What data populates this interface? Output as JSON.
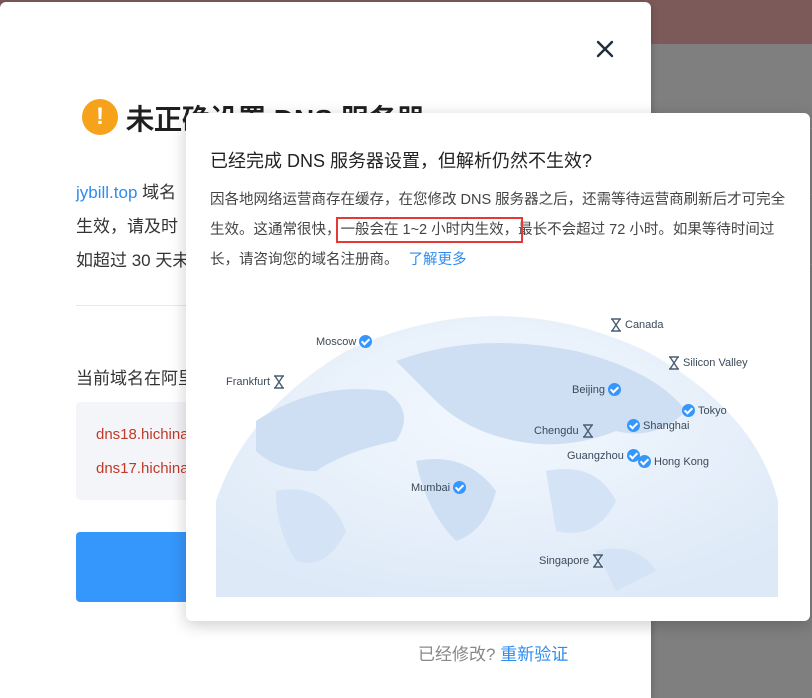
{
  "dialog": {
    "title": "未正确设置 DNS 服务器",
    "desc_domain": "jybill.top",
    "desc_line1": " 域名",
    "desc_line2": "生效，请及时",
    "desc_line3": "如超过 30 天未",
    "current_ns_label": "当前域名在阿里",
    "ns_list": [
      "dns18.hichina",
      "dns17.hichina"
    ],
    "footer_question": "已经修改?",
    "footer_link": "重新验证"
  },
  "popover": {
    "title": "已经完成 DNS 服务器设置，但解析仍然不生效?",
    "body_part1": "因各地网络运营商存在缓存，在您修改 DNS 服务器之后，还需等待运营商刷新后才可完全生效。这通常很快，",
    "body_highlight": "一般会在 1~2 小时内生效，",
    "body_part2": "最长不会超过 72 小时。如果等待时间过长，请咨询您的域名注册商。",
    "learn_more": "了解更多"
  },
  "cities": [
    {
      "name": "Canada",
      "status": "pending"
    },
    {
      "name": "Moscow",
      "status": "done"
    },
    {
      "name": "Silicon Valley",
      "status": "pending"
    },
    {
      "name": "Frankfurt",
      "status": "pending"
    },
    {
      "name": "Beijing",
      "status": "done"
    },
    {
      "name": "Tokyo",
      "status": "done"
    },
    {
      "name": "Shanghai",
      "status": "done"
    },
    {
      "name": "Chengdu",
      "status": "pending"
    },
    {
      "name": "Guangzhou",
      "status": "done"
    },
    {
      "name": "Hong Kong",
      "status": "done"
    },
    {
      "name": "Mumbai",
      "status": "done"
    },
    {
      "name": "Singapore",
      "status": "pending"
    }
  ],
  "colors": {
    "accent": "#3596fb",
    "warning": "#f7a21b",
    "highlight": "#e53935"
  }
}
